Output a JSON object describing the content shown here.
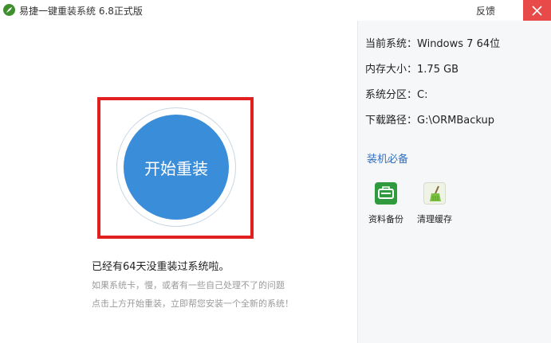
{
  "window": {
    "title": "易捷一键重装系统 6.8正式版",
    "feedback_label": "反馈"
  },
  "main": {
    "start_button_label": "开始重装",
    "days_message": "已经有64天没重装过系统啦。",
    "hint_lines": [
      "如果系统卡，慢，或者有一些自己处理不了的问题",
      "点击上方开始重装，立即帮您安装一个全新的系统！"
    ]
  },
  "sidebar": {
    "info": [
      {
        "label": "当前系统：",
        "value": "Windows 7 64位"
      },
      {
        "label": "内存大小：",
        "value": "1.75 GB"
      },
      {
        "label": "系统分区：",
        "value": "C:"
      },
      {
        "label": "下载路径：",
        "value": "G:\\ORMBackup"
      }
    ],
    "tools_title": "装机必备",
    "tools": [
      {
        "label": "资料备份",
        "icon": "backup-icon",
        "color": "#2f9a3e"
      },
      {
        "label": "清理缓存",
        "icon": "broom-icon",
        "color": "#7cc242"
      }
    ]
  },
  "colors": {
    "accent": "#3a8dd8",
    "highlight_border": "#e02020",
    "close_button": "#e84a4a",
    "link": "#2f6fc1"
  }
}
